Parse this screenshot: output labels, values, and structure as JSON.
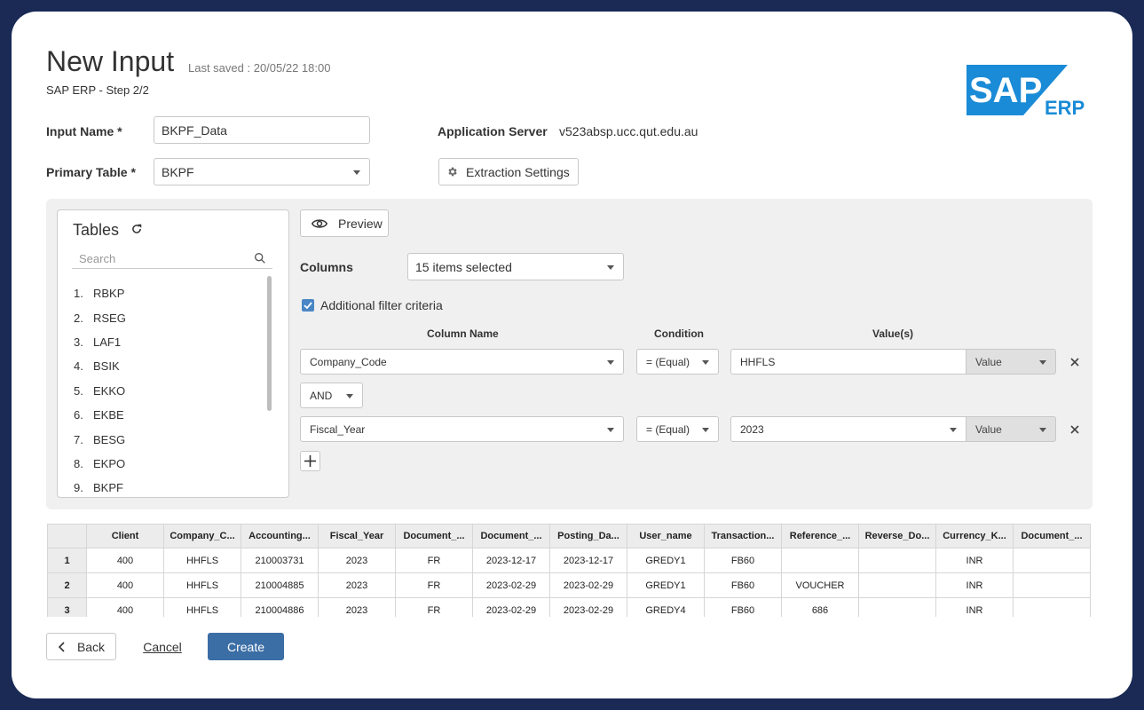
{
  "header": {
    "title": "New Input",
    "last_saved": "Last saved : 20/05/22 18:00",
    "subtitle": "SAP ERP - Step 2/2",
    "logo_text": "SAP",
    "logo_suffix": "ERP",
    "logo_color": "#1a8bd6"
  },
  "form": {
    "input_name_label": "Input Name *",
    "input_name_value": "BKPF_Data",
    "primary_table_label": "Primary Table *",
    "primary_table_value": "BKPF",
    "app_server_label": "Application Server",
    "app_server_value": "v523absp.ucc.qut.edu.au",
    "extraction_settings_label": "Extraction Settings"
  },
  "tables_panel": {
    "title": "Tables",
    "search_placeholder": "Search",
    "items": [
      {
        "num": "1.",
        "name": "RBKP"
      },
      {
        "num": "2.",
        "name": "RSEG"
      },
      {
        "num": "3.",
        "name": "LAF1"
      },
      {
        "num": "4.",
        "name": "BSIK"
      },
      {
        "num": "5.",
        "name": "EKKO"
      },
      {
        "num": "6.",
        "name": "EKBE"
      },
      {
        "num": "7.",
        "name": "BESG"
      },
      {
        "num": "8.",
        "name": "EKPO"
      },
      {
        "num": "9.",
        "name": "BKPF"
      }
    ]
  },
  "config": {
    "preview_label": "Preview",
    "columns_label": "Columns",
    "columns_value": "15 items selected",
    "additional_filter_label": "Additional filter criteria",
    "additional_filter_checked": true,
    "headers": {
      "column_name": "Column Name",
      "condition": "Condition",
      "values": "Value(s)"
    },
    "filters": [
      {
        "column": "Company_Code",
        "condition": "= (Equal)",
        "value": "HHFLS",
        "value_type": "Value"
      },
      {
        "column": "Fiscal_Year",
        "condition": "= (Equal)",
        "value": "2023",
        "value_type": "Value"
      }
    ],
    "logic_operator": "AND"
  },
  "preview_table": {
    "columns": [
      "Client",
      "Company_C...",
      "Accounting...",
      "Fiscal_Year",
      "Document_...",
      "Document_...",
      "Posting_Da...",
      "User_name",
      "Transaction...",
      "Reference_...",
      "Reverse_Do...",
      "Currency_K...",
      "Document_..."
    ],
    "rows": [
      {
        "num": "1",
        "cells": [
          "400",
          "HHFLS",
          "210003731",
          "2023",
          "FR",
          "2023-12-17",
          "2023-12-17",
          "GREDY1",
          "FB60",
          "",
          "",
          "INR",
          ""
        ]
      },
      {
        "num": "2",
        "cells": [
          "400",
          "HHFLS",
          "210004885",
          "2023",
          "FR",
          "2023-02-29",
          "2023-02-29",
          "GREDY1",
          "FB60",
          "VOUCHER",
          "",
          "INR",
          ""
        ]
      },
      {
        "num": "3",
        "cells": [
          "400",
          "HHFLS",
          "210004886",
          "2023",
          "FR",
          "2023-02-29",
          "2023-02-29",
          "GREDY4",
          "FB60",
          "686",
          "",
          "INR",
          ""
        ]
      }
    ]
  },
  "footer": {
    "back_label": "Back",
    "cancel_label": "Cancel",
    "create_label": "Create",
    "create_color": "#3b6ea5"
  }
}
